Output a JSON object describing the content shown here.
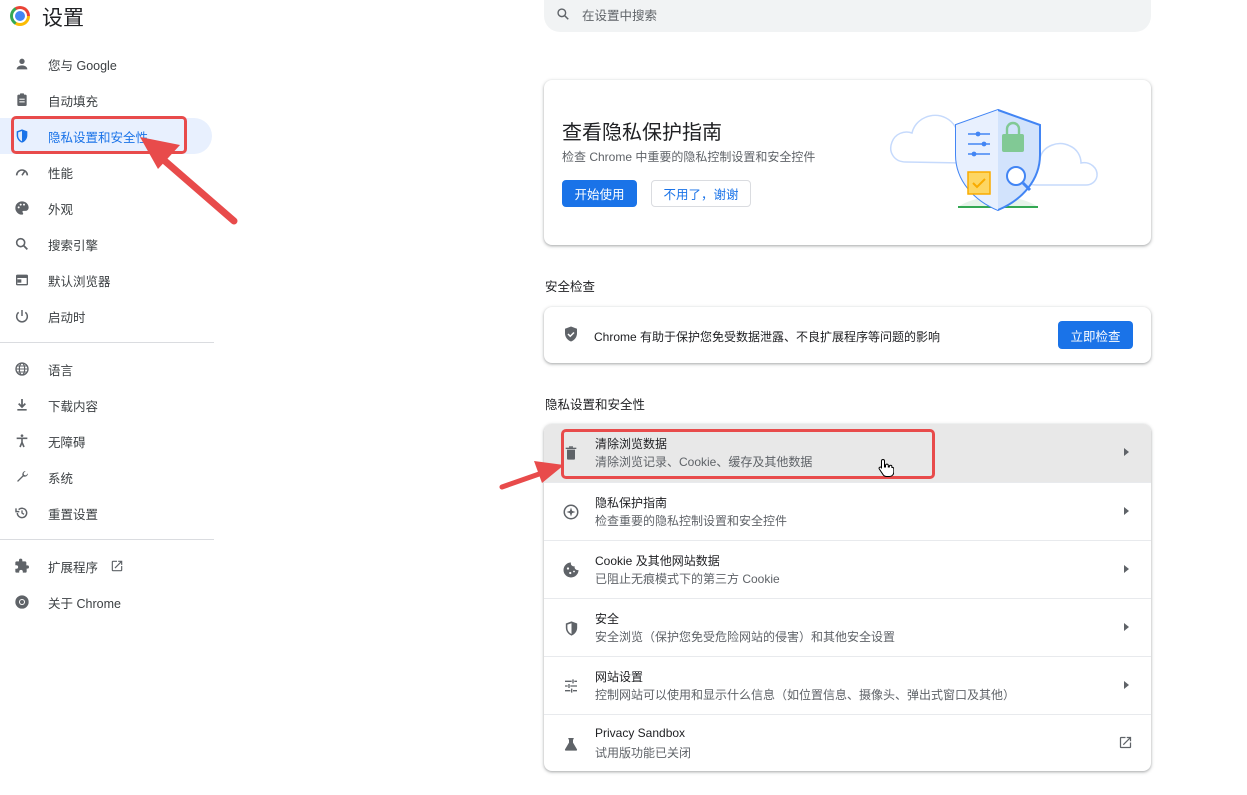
{
  "app": {
    "title": "设置"
  },
  "search": {
    "placeholder": "在设置中搜索",
    "icon": "search-icon"
  },
  "sidebar": {
    "items": [
      {
        "label": "您与 Google",
        "icon": "person-icon"
      },
      {
        "label": "自动填充",
        "icon": "clipboard-icon"
      },
      {
        "label": "隐私设置和安全性",
        "icon": "shield-icon",
        "active": true
      },
      {
        "label": "性能",
        "icon": "speedometer-icon"
      },
      {
        "label": "外观",
        "icon": "palette-icon"
      },
      {
        "label": "搜索引擎",
        "icon": "search-icon"
      },
      {
        "label": "默认浏览器",
        "icon": "browser-icon"
      },
      {
        "label": "启动时",
        "icon": "power-icon"
      },
      {
        "label": "语言",
        "icon": "globe-icon"
      },
      {
        "label": "下载内容",
        "icon": "download-icon"
      },
      {
        "label": "无障碍",
        "icon": "accessibility-icon"
      },
      {
        "label": "系统",
        "icon": "wrench-icon"
      },
      {
        "label": "重置设置",
        "icon": "history-icon"
      },
      {
        "label": "扩展程序",
        "icon": "puzzle-icon"
      },
      {
        "label": "关于 Chrome",
        "icon": "chrome-icon"
      }
    ]
  },
  "promo": {
    "title": "查看隐私保护指南",
    "description": "检查 Chrome 中重要的隐私控制设置和安全控件",
    "start_button": "开始使用",
    "dismiss_button": "不用了，谢谢"
  },
  "safety_check": {
    "section_title": "安全检查",
    "text": "Chrome 有助于保护您免受数据泄露、不良扩展程序等问题的影响",
    "button": "立即检查"
  },
  "privacy_section": {
    "title": "隐私设置和安全性",
    "rows": [
      {
        "title": "清除浏览数据",
        "subtitle": "清除浏览记录、Cookie、缓存及其他数据",
        "icon": "trash-icon"
      },
      {
        "title": "隐私保护指南",
        "subtitle": "检查重要的隐私控制设置和安全控件",
        "icon": "compass-icon"
      },
      {
        "title": "Cookie 及其他网站数据",
        "subtitle": "已阻止无痕模式下的第三方 Cookie",
        "icon": "cookie-icon"
      },
      {
        "title": "安全",
        "subtitle": "安全浏览（保护您免受危险网站的侵害）和其他安全设置",
        "icon": "shield-icon"
      },
      {
        "title": "网站设置",
        "subtitle": "控制网站可以使用和显示什么信息（如位置信息、摄像头、弹出式窗口及其他）",
        "icon": "tune-icon"
      },
      {
        "title": "Privacy Sandbox",
        "subtitle": "试用版功能已关闭",
        "icon": "flask-icon"
      }
    ]
  },
  "colors": {
    "accent": "#1a73e8",
    "annotation": "#e84b4b",
    "active_bg": "#e8f0fe"
  }
}
